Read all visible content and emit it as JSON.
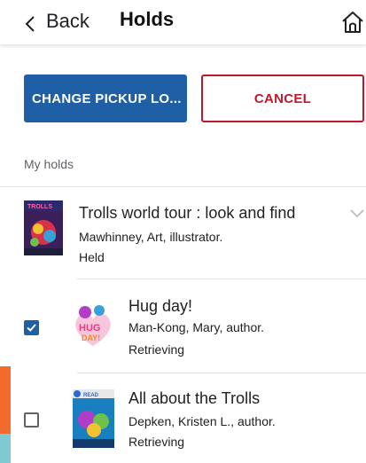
{
  "header": {
    "back_label": "Back",
    "title": "Holds",
    "home_icon": "home-icon"
  },
  "actions": {
    "change_pickup_label": "CHANGE PICKUP LO...",
    "cancel_label": "CANCEL"
  },
  "section": {
    "label": "My holds"
  },
  "holds": [
    {
      "title": "Trolls world tour : look and find",
      "author": "Mawhinney, Art, illustrator.",
      "status": "Held",
      "checked": null,
      "expand_icon": "chevron-down-icon"
    },
    {
      "title": "Hug day!",
      "author": "Man-Kong, Mary, author.",
      "status": "Retrieving",
      "checked": true
    },
    {
      "title": "All about the Trolls",
      "author": "Depken, Kristen L., author.",
      "status": "Retrieving",
      "checked": false
    }
  ],
  "colors": {
    "primary": "#1f5fa5",
    "danger": "#c0182b",
    "muted": "#5f6368"
  }
}
